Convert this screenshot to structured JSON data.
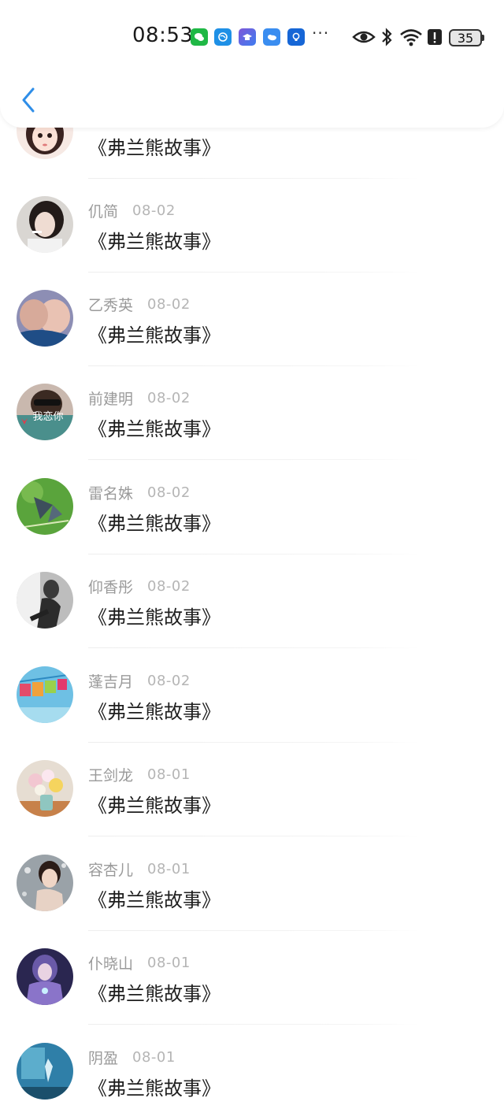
{
  "status_bar": {
    "time": "08:53",
    "battery": "35",
    "notification_icons": [
      "wechat-icon",
      "browser-icon",
      "education-icon",
      "cloud-icon",
      "bulb-icon"
    ],
    "more": "···",
    "system_icons": [
      "eye-icon",
      "bluetooth-icon",
      "wifi-icon",
      "alert-icon"
    ]
  },
  "nav": {
    "back": "back-icon"
  },
  "top_partial_row": {
    "content": "《弗兰熊故事》"
  },
  "comments": [
    {
      "name": "仉简",
      "date": "08-02",
      "content": "《弗兰熊故事》"
    },
    {
      "name": "乙秀英",
      "date": "08-02",
      "content": "《弗兰熊故事》"
    },
    {
      "name": "前建明",
      "date": "08-02",
      "content": "《弗兰熊故事》",
      "avatar_text": "我恋你"
    },
    {
      "name": "雷名姝",
      "date": "08-02",
      "content": "《弗兰熊故事》"
    },
    {
      "name": "仰香彤",
      "date": "08-02",
      "content": "《弗兰熊故事》"
    },
    {
      "name": "蓬吉月",
      "date": "08-02",
      "content": "《弗兰熊故事》"
    },
    {
      "name": "王剑龙",
      "date": "08-01",
      "content": "《弗兰熊故事》"
    },
    {
      "name": "容杏儿",
      "date": "08-01",
      "content": "《弗兰熊故事》"
    },
    {
      "name": "仆晓山",
      "date": "08-01",
      "content": "《弗兰熊故事》"
    },
    {
      "name": "阴盈",
      "date": "08-01",
      "content": "《弗兰熊故事》"
    }
  ],
  "colors": {
    "accent": "#2f8ee8",
    "name_gray": "#9a9a9a",
    "date_gray": "#b5b5b5",
    "text": "#1e1e1e"
  }
}
